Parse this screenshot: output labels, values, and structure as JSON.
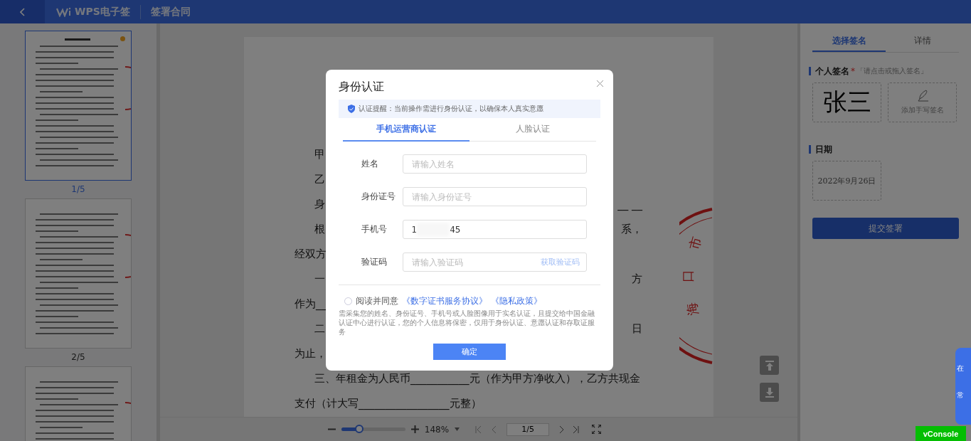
{
  "header": {
    "logo_text": "WPS电子签",
    "title": "签署合同"
  },
  "thumbnails": [
    {
      "label": "1/5",
      "selected": true,
      "flagged": true
    },
    {
      "label": "2/5",
      "selected": false,
      "flagged": false
    },
    {
      "selected": false,
      "flagged": false
    }
  ],
  "document": {
    "lines": [
      {
        "kind": "indent",
        "text": "甲"
      },
      {
        "kind": "indent",
        "text": "乙"
      },
      {
        "kind": "indent",
        "text": "身",
        "right": "__ __"
      },
      {
        "kind": "indent",
        "text": "根",
        "right": "系，"
      },
      {
        "kind": "flush",
        "text": "经双方"
      },
      {
        "kind": "indent",
        "text": "一",
        "right": "方"
      },
      {
        "kind": "flush",
        "text": "作为__"
      },
      {
        "kind": "indent",
        "text": "二",
        "right": "日"
      },
      {
        "kind": "flush",
        "text": "为止，"
      },
      {
        "kind": "indent",
        "text": "三、年租金为人民币___________元（作为甲方净收入），乙方共现金"
      },
      {
        "kind": "flush",
        "text": "支付（计大写_________________元整）"
      }
    ],
    "seal_chars": [
      "海",
      "口",
      "市"
    ]
  },
  "zoom": {
    "level": 0.28,
    "percent": "148%"
  },
  "pager": {
    "value": "1/5"
  },
  "right_panel": {
    "tabs": [
      {
        "label": "选择签名",
        "selected": true
      },
      {
        "label": "详情",
        "selected": false
      }
    ],
    "signature": {
      "title": "个人签名",
      "required_mark": "*",
      "hint": "「请点击或拖入签名」",
      "name": "张三",
      "add_label": "添加手写签名"
    },
    "date": {
      "title": "日期",
      "value": "2022年9月26日"
    },
    "submit": "提交签署"
  },
  "side_float": [
    "在",
    "常"
  ],
  "vconsole": "vConsole",
  "dialog": {
    "title": "身份认证",
    "notice": "认证提醒：当前操作需进行身份认证，以确保本人真实意愿",
    "tabs": [
      {
        "label": "手机运营商认证",
        "selected": true
      },
      {
        "label": "人脸认证",
        "selected": false
      }
    ],
    "fields": [
      {
        "label": "姓名",
        "placeholder": "请输入姓名"
      },
      {
        "label": "身份证号",
        "placeholder": "请输入身份证号"
      },
      {
        "label": "手机号",
        "value": "1",
        "masked": true,
        "value_end": "45"
      },
      {
        "label": "验证码",
        "placeholder": "请输入验证码",
        "action": "获取验证码"
      }
    ],
    "agree": {
      "checked": false,
      "text": "阅读并同意",
      "links": [
        "《数字证书服务协议》",
        "《隐私政策》"
      ]
    },
    "disclaimer": "需采集您的姓名、身份证号、手机号或人脸图像用于实名认证，且提交给中国金融认证中心进行认证，您的个人信息将保密，仅用于身份认证、意愿认证和存取证服务",
    "confirm": "确定"
  }
}
